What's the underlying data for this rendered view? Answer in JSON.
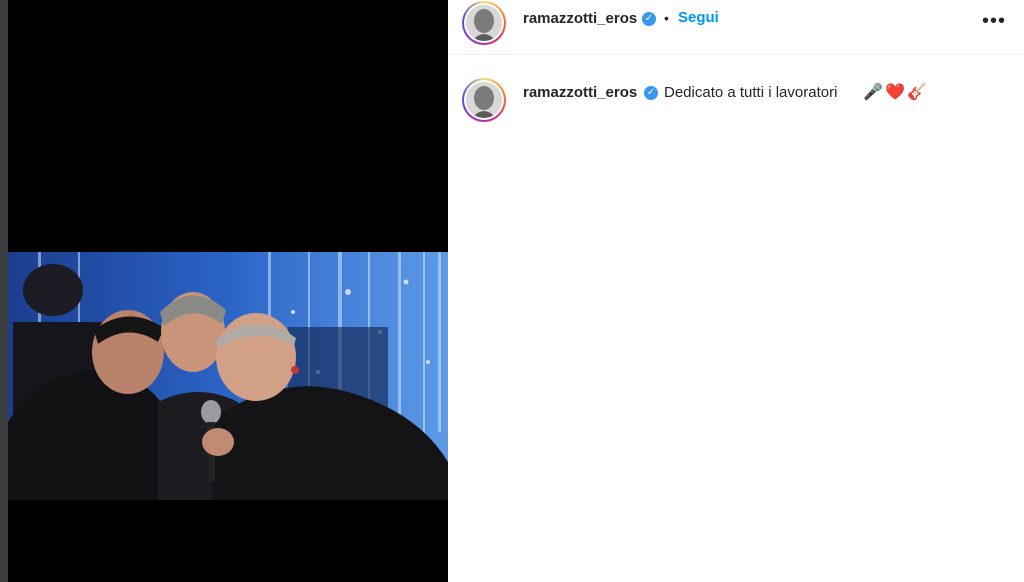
{
  "post": {
    "username": "ramazzotti_eros",
    "verified_icon": "verified-badge-icon",
    "separator": "•",
    "follow_label": "Segui",
    "more_label": "•••",
    "caption_text": "Dedicato a tutti i lavoratori",
    "caption_emojis": [
      "🎤",
      "❤️",
      "🎸"
    ],
    "colors": {
      "link_blue": "#0095f6",
      "verified_blue": "#3897f0",
      "text": "#262626"
    }
  }
}
